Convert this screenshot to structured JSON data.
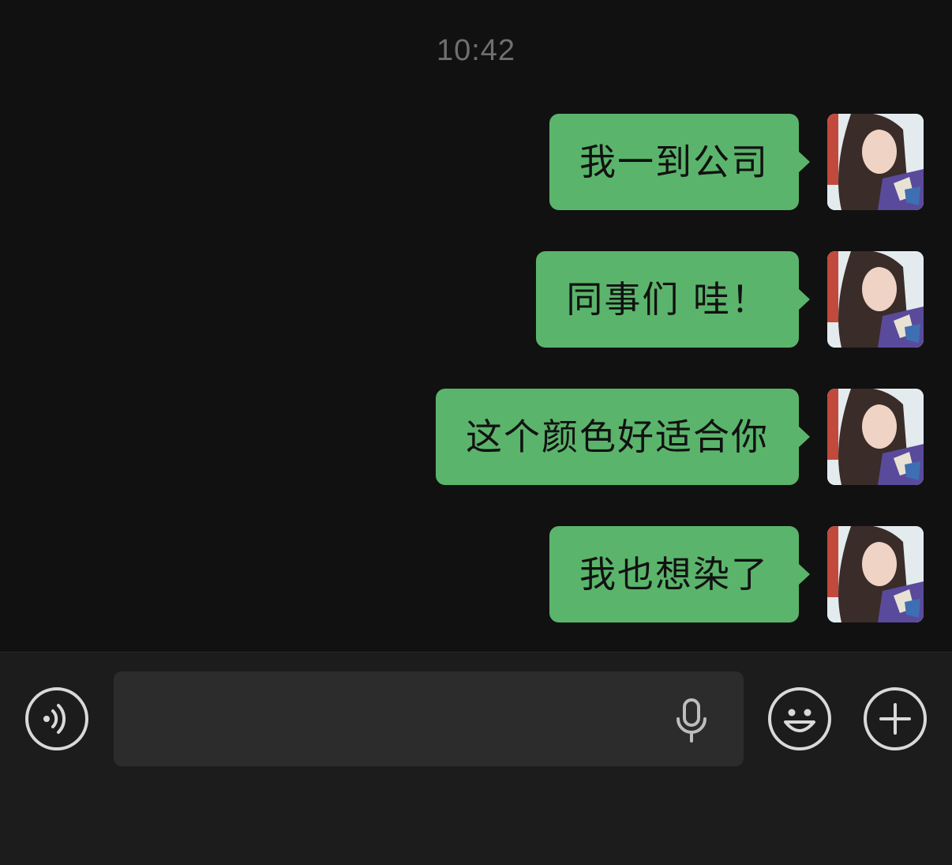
{
  "chat": {
    "timestamp": "10:42",
    "messages": [
      {
        "text": "我一到公司",
        "sender": "self"
      },
      {
        "text": "同事们 哇！",
        "sender": "self"
      },
      {
        "text": "这个颜色好适合你",
        "sender": "self"
      },
      {
        "text": "我也想染了",
        "sender": "self"
      }
    ]
  },
  "input_bar": {
    "text_value": "",
    "icons": {
      "voice": "voice-mode-icon",
      "mic": "microphone-icon",
      "emoji": "emoji-icon",
      "more": "plus-icon"
    }
  },
  "colors": {
    "background": "#111111",
    "bubble": "#5bb46b",
    "input_bar": "#1c1c1c",
    "input_field": "#2c2c2c",
    "timestamp": "#6f6f6f"
  }
}
